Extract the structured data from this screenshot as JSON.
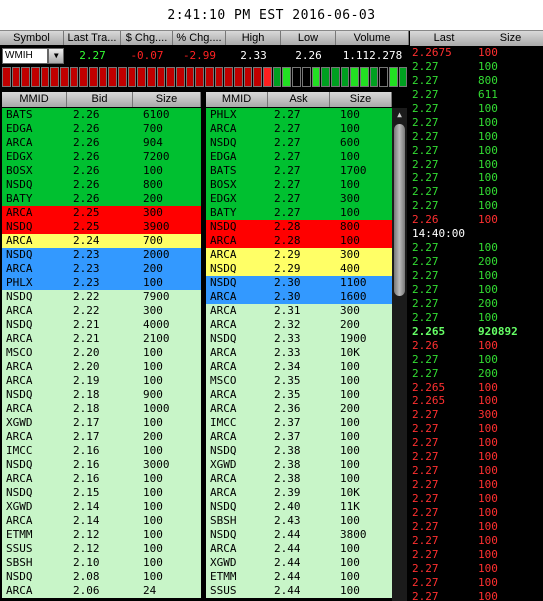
{
  "clock": "2:41:10 PM EST 2016-06-03",
  "quote": {
    "headers": [
      "Symbol",
      "Last Tra...",
      "$ Chg....",
      "% Chg....",
      "High",
      "Low",
      "Volume"
    ],
    "symbol": "WMIH",
    "last": "2.27",
    "chg": "-0.07",
    "pct_chg": "-2.99",
    "high": "2.33",
    "low": "2.26",
    "volume": "1.112.278"
  },
  "tick_bars": [
    "red",
    "red",
    "red",
    "red",
    "red",
    "red",
    "red",
    "red",
    "red",
    "red",
    "red",
    "red",
    "red",
    "red",
    "red",
    "red",
    "red",
    "red",
    "red",
    "red",
    "red",
    "red",
    "red",
    "red",
    "red",
    "red",
    "red",
    "bright-red",
    "green",
    "bright-green",
    "black",
    "black",
    "bright-green",
    "green",
    "green",
    "green",
    "bright-green",
    "bright-green",
    "green",
    "black",
    "bright-green",
    "green"
  ],
  "bid_headers": [
    "MMID",
    "Bid",
    "Size"
  ],
  "ask_headers": [
    "MMID",
    "Ask",
    "Size"
  ],
  "colors": {
    "green": "#00c030",
    "red": "#ff0000",
    "yellow": "#ffff66",
    "blue": "#3399ff",
    "light": "#c8f5c8"
  },
  "bids": [
    [
      "BATS",
      "2.26",
      "6100",
      "green"
    ],
    [
      "EDGA",
      "2.26",
      "700",
      "green"
    ],
    [
      "ARCA",
      "2.26",
      "904",
      "green"
    ],
    [
      "EDGX",
      "2.26",
      "7200",
      "green"
    ],
    [
      "BOSX",
      "2.26",
      "100",
      "green"
    ],
    [
      "NSDQ",
      "2.26",
      "800",
      "green"
    ],
    [
      "BATY",
      "2.26",
      "200",
      "green"
    ],
    [
      "ARCA",
      "2.25",
      "300",
      "red"
    ],
    [
      "NSDQ",
      "2.25",
      "3900",
      "red"
    ],
    [
      "ARCA",
      "2.24",
      "700",
      "yellow"
    ],
    [
      "NSDQ",
      "2.23",
      "2000",
      "blue"
    ],
    [
      "ARCA",
      "2.23",
      "200",
      "blue"
    ],
    [
      "PHLX",
      "2.23",
      "100",
      "blue"
    ],
    [
      "NSDQ",
      "2.22",
      "7900",
      "light"
    ],
    [
      "ARCA",
      "2.22",
      "300",
      "light"
    ],
    [
      "NSDQ",
      "2.21",
      "4000",
      "light"
    ],
    [
      "ARCA",
      "2.21",
      "2100",
      "light"
    ],
    [
      "MSCO",
      "2.20",
      "100",
      "light"
    ],
    [
      "ARCA",
      "2.20",
      "100",
      "light"
    ],
    [
      "ARCA",
      "2.19",
      "100",
      "light"
    ],
    [
      "NSDQ",
      "2.18",
      "900",
      "light"
    ],
    [
      "ARCA",
      "2.18",
      "1000",
      "light"
    ],
    [
      "XGWD",
      "2.17",
      "100",
      "light"
    ],
    [
      "ARCA",
      "2.17",
      "200",
      "light"
    ],
    [
      "IMCC",
      "2.16",
      "100",
      "light"
    ],
    [
      "NSDQ",
      "2.16",
      "3000",
      "light"
    ],
    [
      "ARCA",
      "2.16",
      "100",
      "light"
    ],
    [
      "NSDQ",
      "2.15",
      "100",
      "light"
    ],
    [
      "XGWD",
      "2.14",
      "100",
      "light"
    ],
    [
      "ARCA",
      "2.14",
      "100",
      "light"
    ],
    [
      "ETMM",
      "2.12",
      "100",
      "light"
    ],
    [
      "SSUS",
      "2.12",
      "100",
      "light"
    ],
    [
      "SBSH",
      "2.10",
      "100",
      "light"
    ],
    [
      "NSDQ",
      "2.08",
      "100",
      "light"
    ],
    [
      "ARCA",
      "2.06",
      "24",
      "light"
    ]
  ],
  "asks": [
    [
      "PHLX",
      "2.27",
      "100",
      "green"
    ],
    [
      "ARCA",
      "2.27",
      "100",
      "green"
    ],
    [
      "NSDQ",
      "2.27",
      "600",
      "green"
    ],
    [
      "EDGA",
      "2.27",
      "100",
      "green"
    ],
    [
      "BATS",
      "2.27",
      "1700",
      "green"
    ],
    [
      "BOSX",
      "2.27",
      "100",
      "green"
    ],
    [
      "EDGX",
      "2.27",
      "300",
      "green"
    ],
    [
      "BATY",
      "2.27",
      "100",
      "green"
    ],
    [
      "NSDQ",
      "2.28",
      "800",
      "red"
    ],
    [
      "ARCA",
      "2.28",
      "100",
      "red"
    ],
    [
      "ARCA",
      "2.29",
      "300",
      "yellow"
    ],
    [
      "NSDQ",
      "2.29",
      "400",
      "yellow"
    ],
    [
      "NSDQ",
      "2.30",
      "1100",
      "blue"
    ],
    [
      "ARCA",
      "2.30",
      "1600",
      "blue"
    ],
    [
      "ARCA",
      "2.31",
      "300",
      "light"
    ],
    [
      "ARCA",
      "2.32",
      "200",
      "light"
    ],
    [
      "NSDQ",
      "2.33",
      "1900",
      "light"
    ],
    [
      "ARCA",
      "2.33",
      "10K",
      "light"
    ],
    [
      "ARCA",
      "2.34",
      "100",
      "light"
    ],
    [
      "MSCO",
      "2.35",
      "100",
      "light"
    ],
    [
      "ARCA",
      "2.35",
      "100",
      "light"
    ],
    [
      "ARCA",
      "2.36",
      "200",
      "light"
    ],
    [
      "IMCC",
      "2.37",
      "100",
      "light"
    ],
    [
      "ARCA",
      "2.37",
      "100",
      "light"
    ],
    [
      "NSDQ",
      "2.38",
      "100",
      "light"
    ],
    [
      "XGWD",
      "2.38",
      "100",
      "light"
    ],
    [
      "ARCA",
      "2.38",
      "100",
      "light"
    ],
    [
      "ARCA",
      "2.39",
      "10K",
      "light"
    ],
    [
      "NSDQ",
      "2.40",
      "11K",
      "light"
    ],
    [
      "SBSH",
      "2.43",
      "100",
      "light"
    ],
    [
      "NSDQ",
      "2.44",
      "3800",
      "light"
    ],
    [
      "ARCA",
      "2.44",
      "100",
      "light"
    ],
    [
      "XGWD",
      "2.44",
      "100",
      "light"
    ],
    [
      "ETMM",
      "2.44",
      "100",
      "light"
    ],
    [
      "SSUS",
      "2.44",
      "100",
      "light"
    ]
  ],
  "ts_headers": [
    "Last",
    "Size"
  ],
  "time_sales": [
    [
      "2.2675",
      "100",
      "red"
    ],
    [
      "2.27",
      "100",
      "green"
    ],
    [
      "2.27",
      "800",
      "green"
    ],
    [
      "2.27",
      "611",
      "green"
    ],
    [
      "2.27",
      "100",
      "green"
    ],
    [
      "2.27",
      "100",
      "green"
    ],
    [
      "2.27",
      "100",
      "green"
    ],
    [
      "2.27",
      "100",
      "green"
    ],
    [
      "2.27",
      "100",
      "green"
    ],
    [
      "2.27",
      "100",
      "green"
    ],
    [
      "2.27",
      "100",
      "green"
    ],
    [
      "2.27",
      "100",
      "green"
    ],
    [
      "2.26",
      "100",
      "red"
    ],
    [
      "14:40:00",
      "",
      "white"
    ],
    [
      "2.27",
      "100",
      "green"
    ],
    [
      "2.27",
      "200",
      "green"
    ],
    [
      "2.27",
      "100",
      "green"
    ],
    [
      "2.27",
      "100",
      "green"
    ],
    [
      "2.27",
      "200",
      "green"
    ],
    [
      "2.27",
      "100",
      "green"
    ],
    [
      "2.265",
      "920892",
      "bright-bold"
    ],
    [
      "2.26",
      "100",
      "red"
    ],
    [
      "2.27",
      "100",
      "green"
    ],
    [
      "2.27",
      "200",
      "green"
    ],
    [
      "2.265",
      "100",
      "red"
    ],
    [
      "2.265",
      "100",
      "red"
    ],
    [
      "2.27",
      "300",
      "red"
    ],
    [
      "2.27",
      "100",
      "red"
    ],
    [
      "2.27",
      "100",
      "red"
    ],
    [
      "2.27",
      "100",
      "red"
    ],
    [
      "2.27",
      "100",
      "red"
    ],
    [
      "2.27",
      "100",
      "red"
    ],
    [
      "2.27",
      "100",
      "red"
    ],
    [
      "2.27",
      "100",
      "red"
    ],
    [
      "2.27",
      "100",
      "red"
    ],
    [
      "2.27",
      "100",
      "red"
    ],
    [
      "2.27",
      "100",
      "red"
    ],
    [
      "2.27",
      "100",
      "red"
    ],
    [
      "2.27",
      "100",
      "red"
    ],
    [
      "2.27",
      "100",
      "red"
    ]
  ]
}
